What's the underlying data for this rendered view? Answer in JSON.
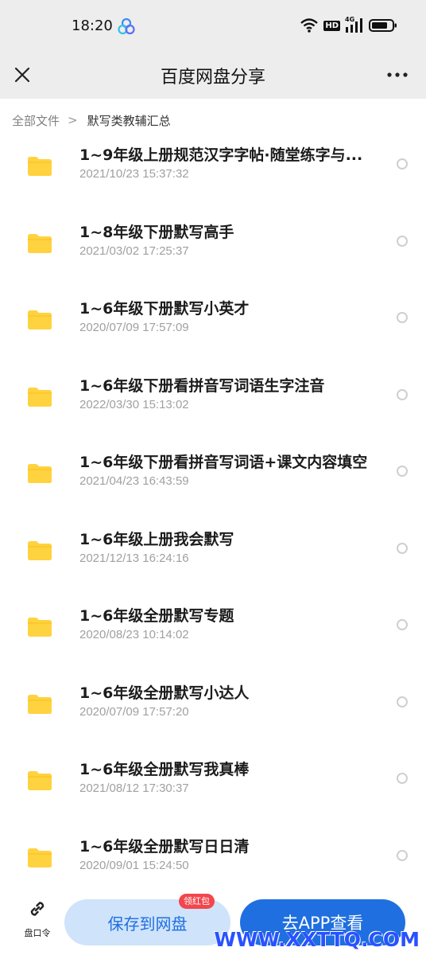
{
  "status": {
    "time": "18:20",
    "hd_label": "HD",
    "net_label": "4G"
  },
  "header": {
    "title": "百度网盘分享"
  },
  "breadcrumb": {
    "root": "全部文件",
    "separator": ">",
    "current": "默写类教辅汇总"
  },
  "files": [
    {
      "name": "1~9年级上册规范汉字字帖·随堂练字与...",
      "date": "2021/10/23 15:37:32"
    },
    {
      "name": "1~8年级下册默写高手",
      "date": "2021/03/02 17:25:37"
    },
    {
      "name": "1~6年级下册默写小英才",
      "date": "2020/07/09 17:57:09"
    },
    {
      "name": "1~6年级下册看拼音写词语生字注音",
      "date": "2022/03/30 15:13:02"
    },
    {
      "name": "1~6年级下册看拼音写词语+课文内容填空",
      "date": "2021/04/23 16:43:59"
    },
    {
      "name": "1~6年级上册我会默写",
      "date": "2021/12/13 16:24:16"
    },
    {
      "name": "1~6年级全册默写专题",
      "date": "2020/08/23 10:14:02"
    },
    {
      "name": "1~6年级全册默写小达人",
      "date": "2020/07/09 17:57:20"
    },
    {
      "name": "1~6年级全册默写我真棒",
      "date": "2021/08/12 17:30:37"
    },
    {
      "name": "1~6年级全册默写日日清",
      "date": "2020/09/01 15:24:50"
    }
  ],
  "bottom": {
    "code_label": "盘口令",
    "save_label": "保存到网盘",
    "save_badge": "领红包",
    "app_label": "去APP查看"
  },
  "watermark": "WWW.XXTTQ.COM",
  "colors": {
    "accent": "#1f6fe0",
    "folder": "#ffd23f",
    "badge": "#f2474d"
  }
}
